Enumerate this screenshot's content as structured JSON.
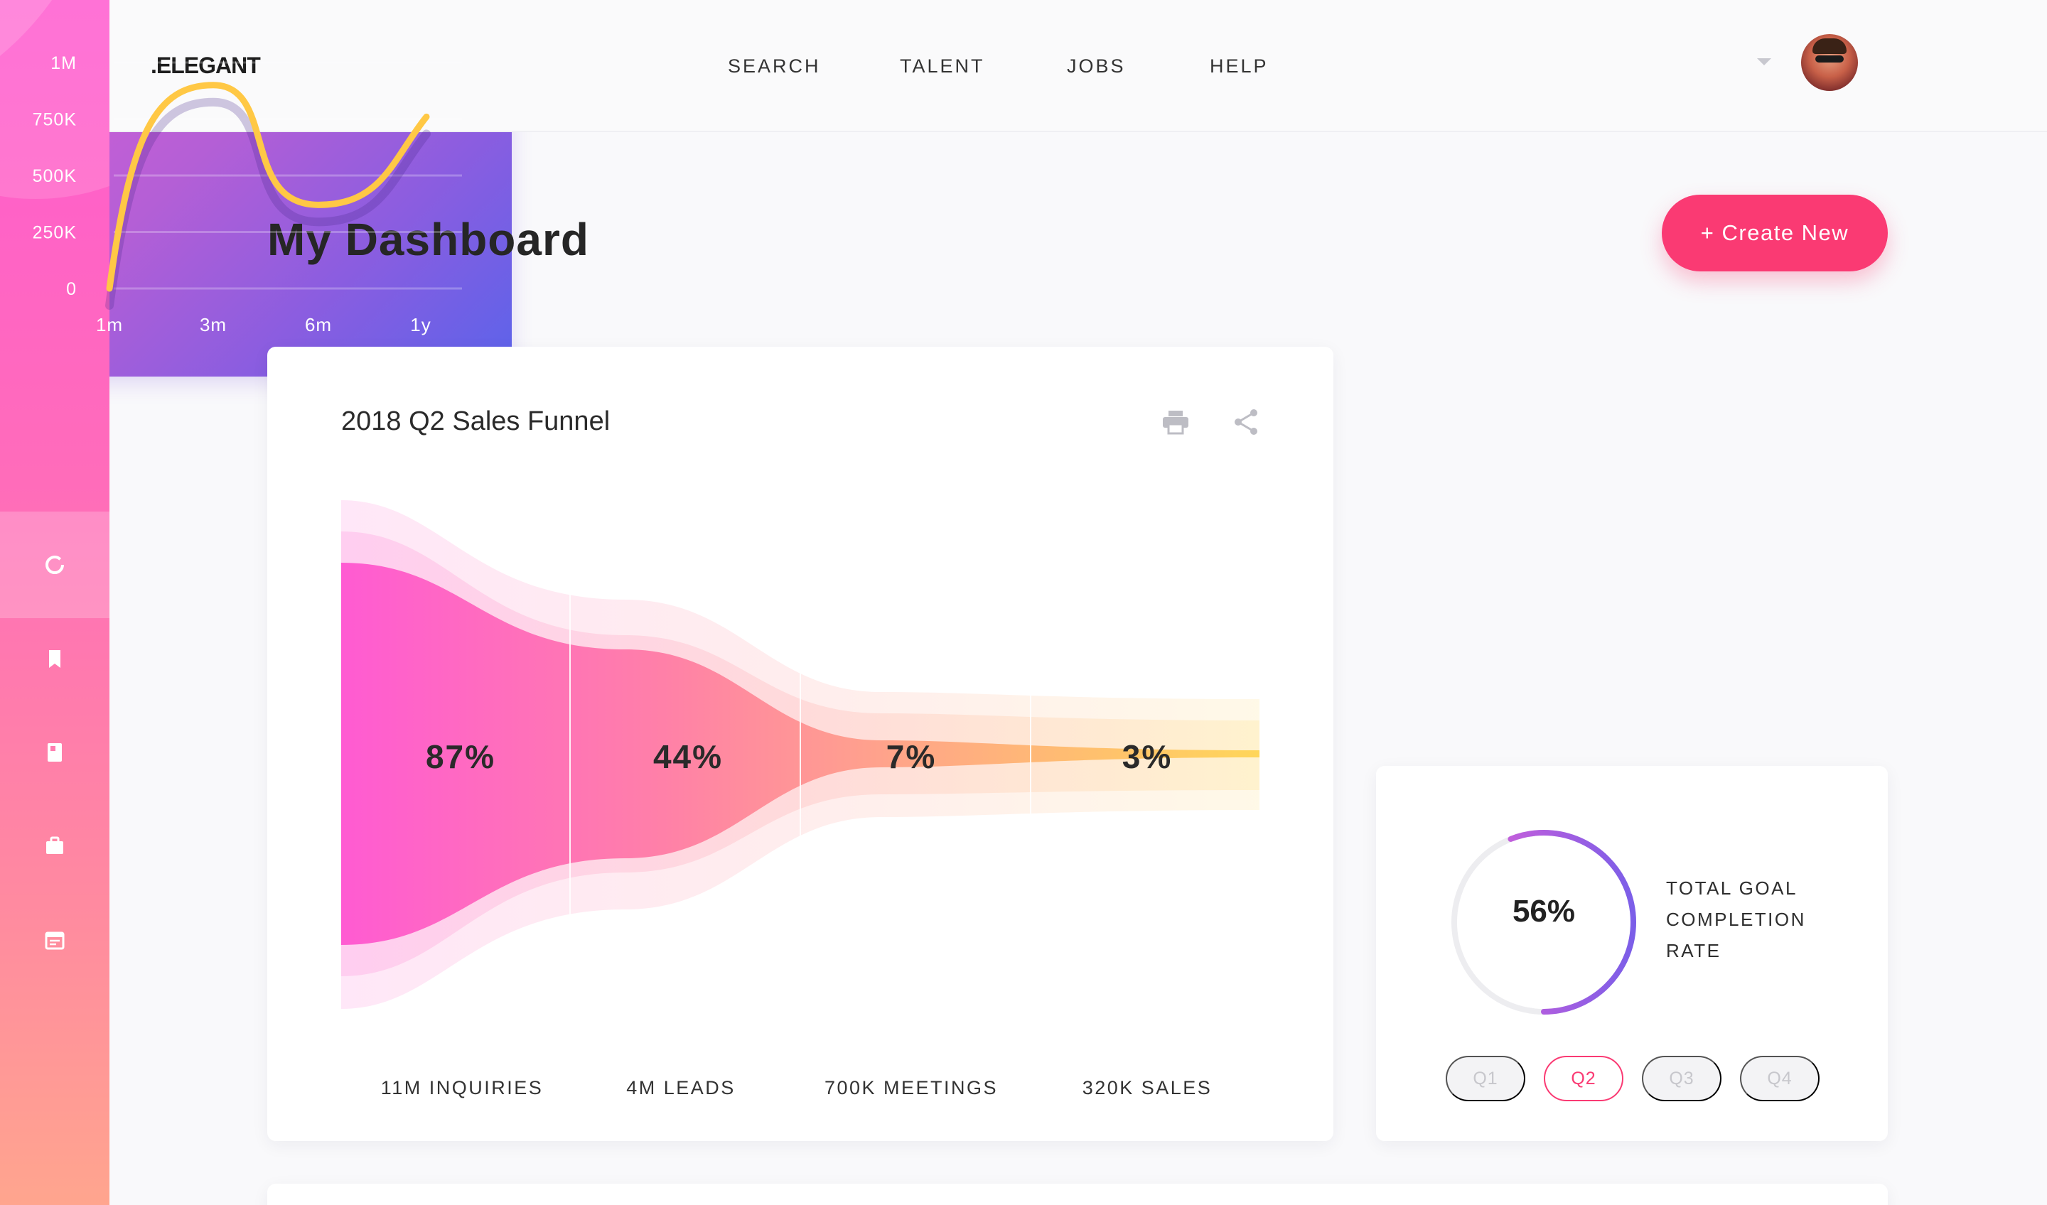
{
  "brand": {
    "logo": ".ELEGANT",
    "accent": "#fa3a73"
  },
  "nav": {
    "items": [
      "SEARCH",
      "TALENT",
      "JOBS",
      "HELP"
    ]
  },
  "sidebar": {
    "icons": [
      "donut-chart-icon",
      "bookmark-icon",
      "book-icon",
      "briefcase-icon",
      "calendar-icon"
    ],
    "active_index": 0
  },
  "header": {
    "title": "My Dashboard",
    "create_label": "+ Create New"
  },
  "funnel": {
    "title": "2018 Q2 Sales Funnel",
    "stages": [
      {
        "percent": "87%",
        "label": "11M INQUIRIES"
      },
      {
        "percent": "44%",
        "label": "4M LEADS"
      },
      {
        "percent": "7%",
        "label": "700K MEETINGS"
      },
      {
        "percent": "3%",
        "label": "320K SALES"
      }
    ]
  },
  "chart_data": {
    "type": "line",
    "categories": [
      "1m",
      "3m",
      "6m",
      "1y"
    ],
    "y_ticks": [
      "0",
      "250K",
      "500K",
      "750K",
      "1M"
    ],
    "ylim": [
      0,
      1000000
    ],
    "series": [
      {
        "values": [
          0,
          900000,
          370000,
          760000
        ],
        "color": "#ffc845"
      }
    ],
    "grid": true
  },
  "goal": {
    "value": "56%",
    "fraction": 0.56,
    "label_lines": [
      "TOTAL GOAL",
      "COMPLETION",
      "RATE"
    ],
    "quarters": [
      "Q1",
      "Q2",
      "Q3",
      "Q4"
    ],
    "active_quarter": "Q2"
  }
}
